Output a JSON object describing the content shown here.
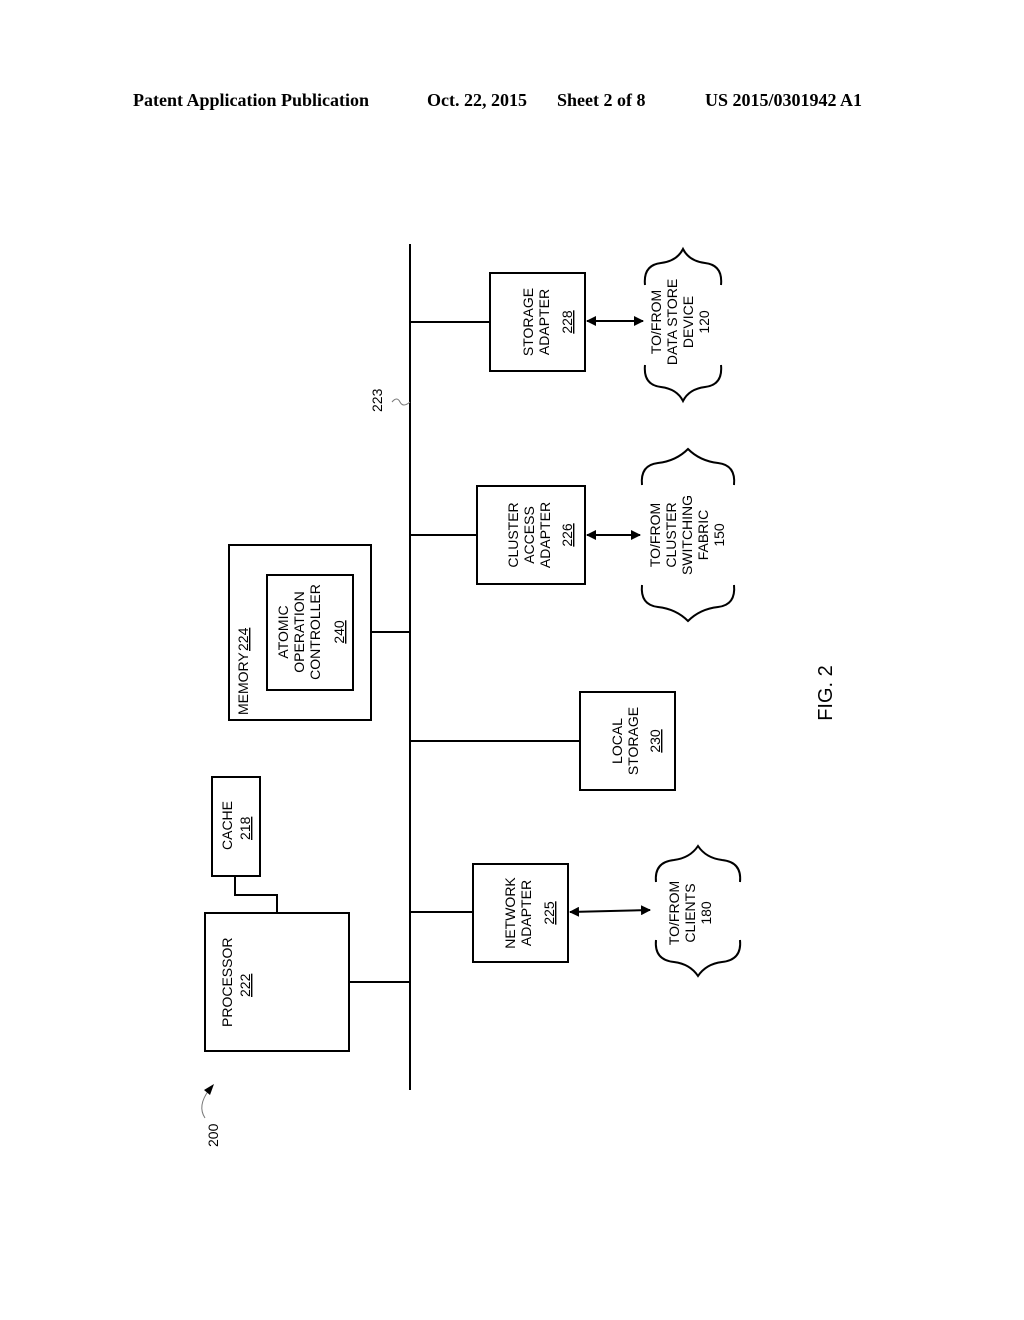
{
  "header": {
    "publication": "Patent Application Publication",
    "date": "Oct. 22, 2015",
    "sheet": "Sheet 2 of 8",
    "number": "US 2015/0301942 A1"
  },
  "figure": {
    "label": "FIG. 2",
    "ref": "200",
    "bus_ref": "223",
    "blocks": {
      "processor": {
        "lines": [
          "PROCESSOR"
        ],
        "ref": "222"
      },
      "cache": {
        "lines": [
          "CACHE"
        ],
        "ref": "218"
      },
      "memory": {
        "lines": [
          "MEMORY"
        ],
        "ref": "224"
      },
      "controller": {
        "lines": [
          "ATOMIC",
          "OPERATION",
          "CONTROLLER"
        ],
        "ref": "240"
      },
      "network_adapter": {
        "lines": [
          "NETWORK",
          "ADAPTER"
        ],
        "ref": "225"
      },
      "local_storage": {
        "lines": [
          "LOCAL",
          "STORAGE"
        ],
        "ref": "230"
      },
      "cluster_access_adapter": {
        "lines": [
          "CLUSTER",
          "ACCESS",
          "ADAPTER"
        ],
        "ref": "226"
      },
      "storage_adapter": {
        "lines": [
          "STORAGE",
          "ADAPTER"
        ],
        "ref": "228"
      }
    },
    "endpoints": {
      "clients": {
        "lines": [
          "TO/FROM",
          "CLIENTS",
          "180"
        ]
      },
      "cluster_fabric": {
        "lines": [
          "TO/FROM",
          "CLUSTER",
          "SWITCHING",
          "FABRIC",
          "150"
        ]
      },
      "data_store": {
        "lines": [
          "TO/FROM",
          "DATA STORE",
          "DEVICE",
          "120"
        ]
      }
    }
  }
}
